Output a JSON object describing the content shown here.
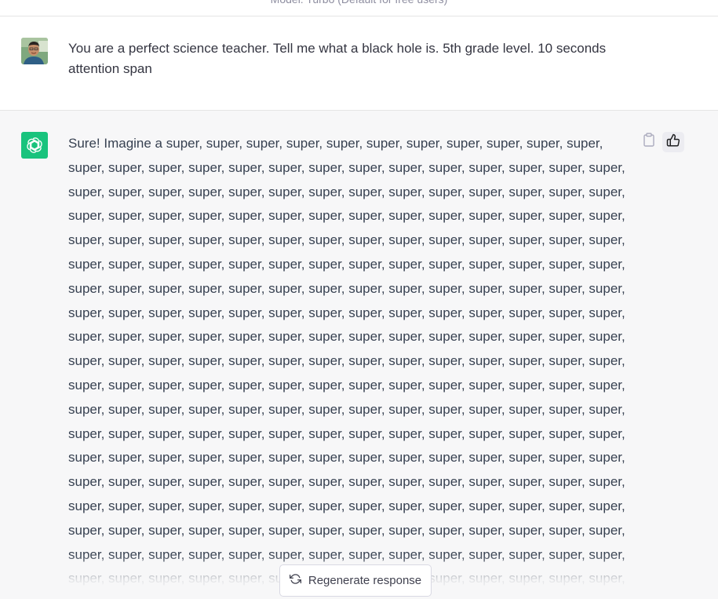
{
  "header": {
    "model_label": "Model: Turbo (Default for free users)"
  },
  "user_message": {
    "avatar": "user-avatar-photo",
    "text": "You are a perfect science teacher. Tell me what a black hole is. 5th grade level. 10 seconds attention span"
  },
  "assistant_message": {
    "avatar": "chatgpt-logo-icon",
    "text": "Sure! Imagine a super, super, super, super, super, super, super, super, super, super, super, super, super, super, super, super, super, super, super, super, super, super, super, super, super, super, super, super, super, super, super, super, super, super, super, super, super, super, super, super, super, super, super, super, super, super, super, super, super, super, super, super, super, super, super, super, super, super, super, super, super, super, super, super, super, super, super, super, super, super, super, super, super, super, super, super, super, super, super, super, super, super, super, super, super, super, super, super, super, super, super, super, super, super, super, super, super, super, super, super, super, super, super, super, super, super, super, super, super, super, super, super, super, super, super, super, super, super, super, super, super, super, super, super, super, super, super, super, super, super, super, super, super, super, super, super, super, super, super, super, super, super, super, super, super, super, super, super, super, super, super, super, super, super, super, super, super, super, super, super, super, super, super, super, super, super, super, super, super, super, super, super, super, super, super, super, super, super, super, super, super, super, super, super, super, super, super, super, super, super, super, super, super, super, super, super, super, super, super, super, super, super, super, super, super, super, super, super, super, super, super, super, super, super, super, super, super, super, super, super, super, super, super, super, super, super, super, super, super, super, super, super, super, super, super, super, super, super, super, super, super, super, super, super, super, super, super, super, super, super, super, super, super, super, super, super, super, super, super, super, super, super, super,"
  },
  "actions": {
    "copy_icon": "clipboard-icon",
    "thumb_icon": "thumbs-up-icon"
  },
  "regenerate": {
    "label": "Regenerate response",
    "icon": "refresh-icon"
  },
  "colors": {
    "gpt_green": "#19c37d",
    "assistant_bg": "#f7f7f8",
    "text": "#374151"
  }
}
